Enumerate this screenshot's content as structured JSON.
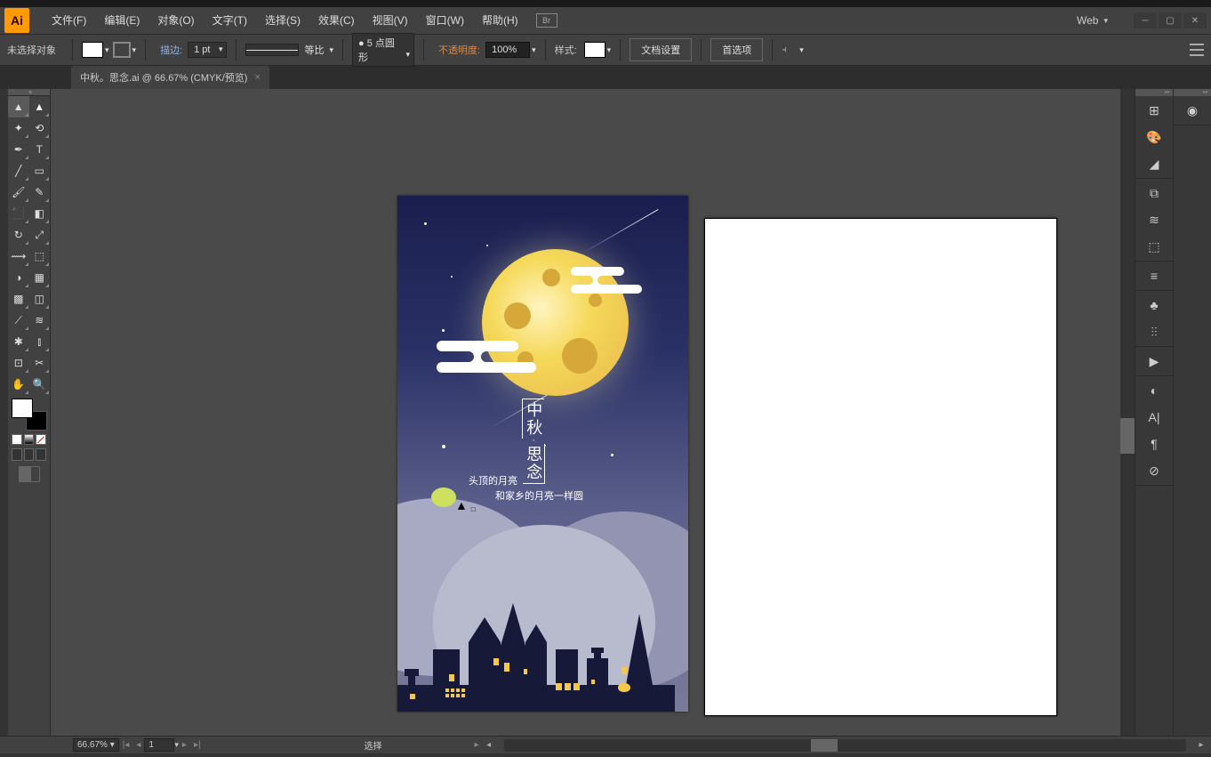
{
  "titlebar": {},
  "menubar": {
    "app": "Ai",
    "items": [
      "文件(F)",
      "编辑(E)",
      "对象(O)",
      "文字(T)",
      "选择(S)",
      "效果(C)",
      "视图(V)",
      "窗口(W)",
      "帮助(H)"
    ],
    "br": "Br",
    "workspace": "Web"
  },
  "controlbar": {
    "selection": "未选择对象",
    "stroke_label": "描边:",
    "stroke_weight": "1 pt",
    "profile": "等比",
    "brush": "5 点圆形",
    "opacity_label": "不透明度:",
    "opacity": "100%",
    "style_label": "样式:",
    "doc_setup": "文档设置",
    "prefs": "首选项"
  },
  "tab": {
    "title": "中秋。思念.ai @ 66.67% (CMYK/预览)"
  },
  "artwork": {
    "title_v": "中秋·思念",
    "line1": "头顶的月亮",
    "line2": "和家乡的月亮一样圆"
  },
  "statusbar": {
    "zoom": "66.67%",
    "artboard": "1",
    "tool": "选择"
  },
  "tools": {
    "sel": "selection",
    "dsel": "direct-selection",
    "wand": "magic-wand",
    "lasso": "lasso",
    "pen": "pen",
    "type": "type",
    "line": "line",
    "rect": "rectangle",
    "brush": "brush",
    "pencil": "pencil",
    "blob": "blob-brush",
    "eraser": "eraser",
    "rotate": "rotate",
    "scale": "scale",
    "width": "width",
    "warp": "free-transform",
    "shaper": "shape-builder",
    "perspective": "perspective",
    "mesh": "mesh",
    "gradient": "gradient",
    "eye": "eyedropper",
    "blend": "blend",
    "symbol": "symbol-sprayer",
    "graph": "column-graph",
    "artboard": "artboard",
    "slice": "slice",
    "hand": "hand",
    "zoom": "zoom"
  }
}
